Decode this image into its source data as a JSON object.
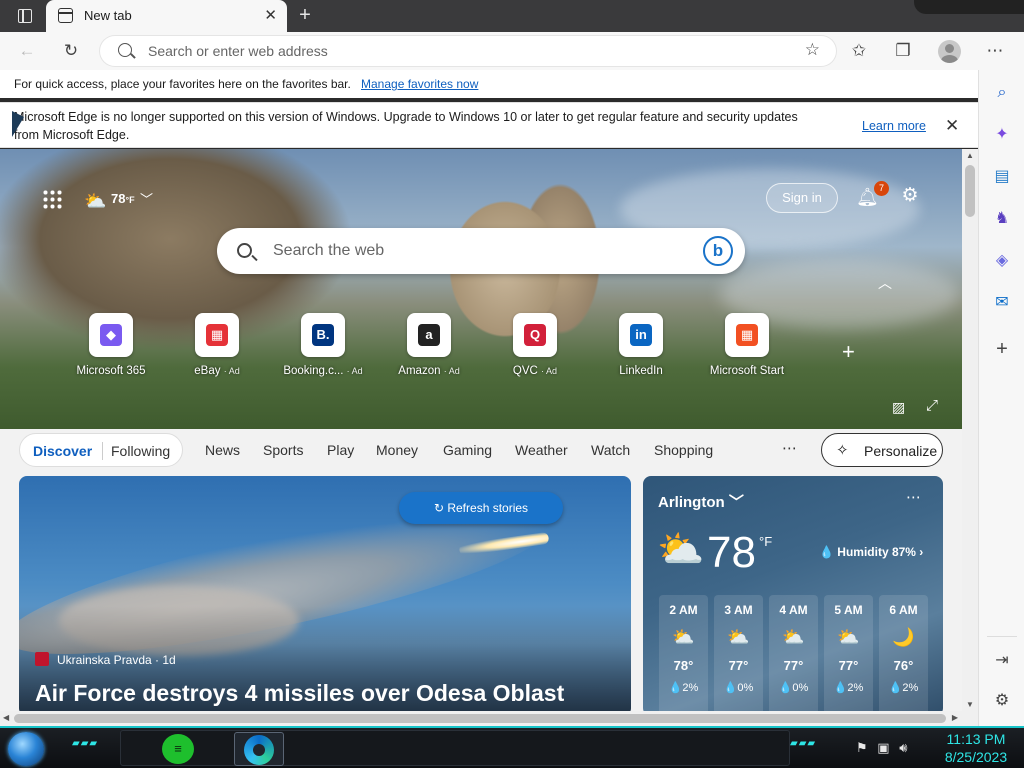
{
  "tab": {
    "title": "New tab"
  },
  "address": {
    "placeholder": "Search or enter web address"
  },
  "favorites_bar": {
    "message": "For quick access, place your favorites here on the favorites bar.",
    "link": "Manage favorites now"
  },
  "infobar": {
    "line1": "Microsoft Edge is no longer supported on this version of Windows. Upgrade to Windows 10 or later to get regular feature and security updates",
    "line2": "from Microsoft Edge.",
    "learn_more": "Learn more"
  },
  "hero": {
    "weather_temp": "78",
    "weather_unit": "°F",
    "sign_in": "Sign in",
    "notification_count": "7",
    "search_placeholder": "Search the web",
    "quick_links": [
      {
        "label": "Microsoft 365",
        "ad": "",
        "glyph": "◆",
        "color": "#7a5af0"
      },
      {
        "label": "eBay",
        "ad": "· Ad",
        "glyph": "▦",
        "color": "#e53238"
      },
      {
        "label": "Booking.c...",
        "ad": "· Ad",
        "glyph": "B.",
        "color": "#003580"
      },
      {
        "label": "Amazon",
        "ad": "· Ad",
        "glyph": "a",
        "color": "#222222"
      },
      {
        "label": "QVC",
        "ad": "· Ad",
        "glyph": "Q",
        "color": "#d2203a"
      },
      {
        "label": "LinkedIn",
        "ad": "",
        "glyph": "in",
        "color": "#0a66c2"
      },
      {
        "label": "Microsoft Start",
        "ad": "",
        "glyph": "▦",
        "color": "#f25022"
      }
    ]
  },
  "feed": {
    "discover": "Discover",
    "following": "Following",
    "nav": [
      "News",
      "Sports",
      "Play",
      "Money",
      "Gaming",
      "Weather",
      "Watch",
      "Shopping"
    ],
    "personalize": "Personalize"
  },
  "story": {
    "refresh": "Refresh stories",
    "source": "Ukrainska Pravda · 1d",
    "title": "Air Force destroys 4 missiles over Odesa Oblast"
  },
  "weather": {
    "city": "Arlington",
    "temp": "78",
    "unit": "°F",
    "humidity": "Humidity 87%",
    "hours": [
      {
        "time": "2 AM",
        "temp": "78°",
        "precip": "2%",
        "icon": "⛅"
      },
      {
        "time": "3 AM",
        "temp": "77°",
        "precip": "0%",
        "icon": "⛅"
      },
      {
        "time": "4 AM",
        "temp": "77°",
        "precip": "0%",
        "icon": "⛅"
      },
      {
        "time": "5 AM",
        "temp": "77°",
        "precip": "2%",
        "icon": "⛅"
      },
      {
        "time": "6 AM",
        "temp": "76°",
        "precip": "2%",
        "icon": "🌙"
      }
    ]
  },
  "taskbar": {
    "time": "11:13 PM",
    "date": "8/25/2023"
  }
}
